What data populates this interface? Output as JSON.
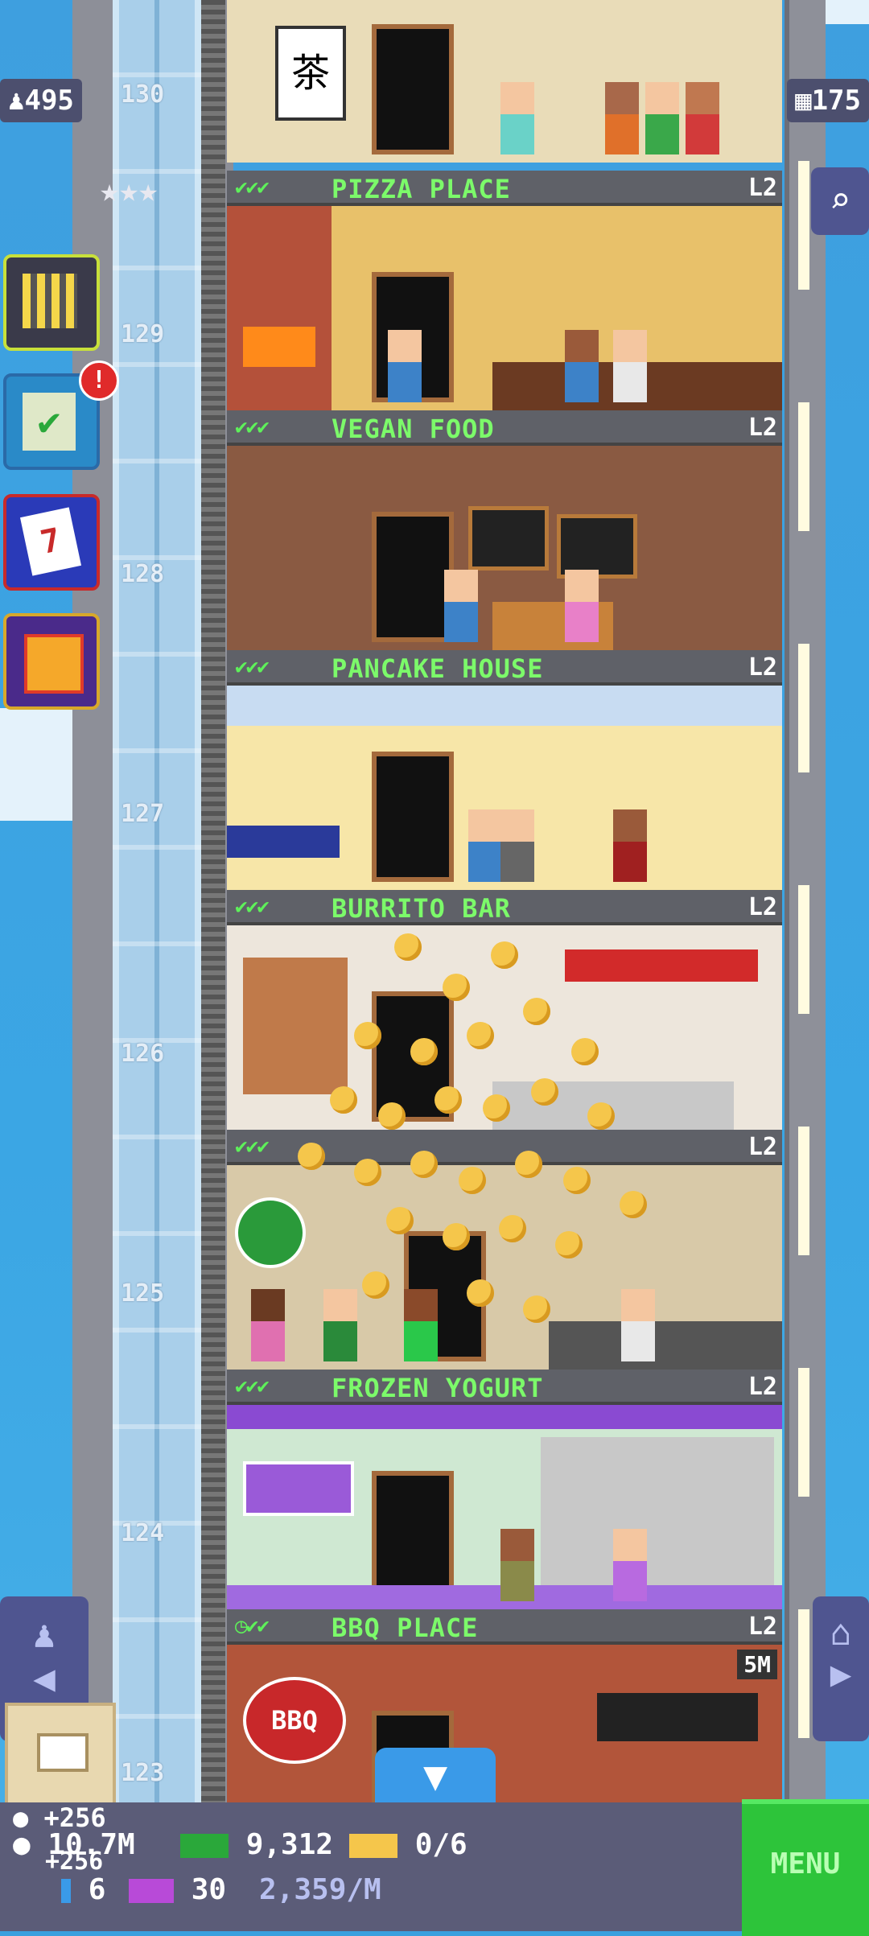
{
  "hud": {
    "population": "495",
    "floors_total": "175",
    "stars": 3
  },
  "floors": [
    {
      "number": "130",
      "name": "",
      "level": ""
    },
    {
      "number": "129",
      "name": "PIZZA PLACE",
      "level": "L2",
      "status": "checks"
    },
    {
      "number": "128",
      "name": "VEGAN FOOD",
      "level": "L2",
      "status": "checks"
    },
    {
      "number": "127",
      "name": "PANCAKE HOUSE",
      "level": "L2",
      "status": "checks"
    },
    {
      "number": "126",
      "name": "BURRITO BAR",
      "level": "L2",
      "status": "checks"
    },
    {
      "number": "125",
      "name": "",
      "level": "L2",
      "status": "checks"
    },
    {
      "number": "124",
      "name": "FROZEN YOGURT",
      "level": "L2",
      "status": "checks"
    },
    {
      "number": "123",
      "name": "BBQ PLACE",
      "level": "L2",
      "status": "clock",
      "timer": "5M",
      "sign": "BBQ"
    }
  ],
  "side_buttons": [
    {
      "name": "build",
      "icon": "building-icon"
    },
    {
      "name": "missions",
      "icon": "checklist-icon",
      "badge": "!"
    },
    {
      "name": "calendar",
      "icon": "calendar-icon",
      "label": "7"
    },
    {
      "name": "gift",
      "icon": "gift-icon"
    }
  ],
  "bottom": {
    "gain_coins": "+256",
    "gain_coins_2": "+256",
    "coins": "10.7M",
    "bux": "9,312",
    "tickets": "0/6",
    "bitizens": "6",
    "vip": "30",
    "rate": "2,359/M",
    "menu": "MENU"
  },
  "colors": {
    "sky": "#3ea0df",
    "label_green": "#7cfa6a",
    "hud_bg": "#4c4f6e",
    "menu_green": "#2dc43a"
  }
}
